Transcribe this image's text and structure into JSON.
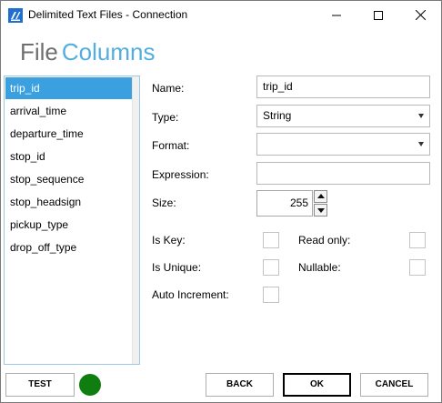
{
  "window": {
    "title": "Delimited Text Files - Connection",
    "icon": "app-icon",
    "controls": [
      "minimize-icon",
      "maximize-icon",
      "close-icon"
    ]
  },
  "header": {
    "word1": "File",
    "word2": "Columns"
  },
  "columns": {
    "items": [
      {
        "label": "trip_id",
        "selected": true
      },
      {
        "label": "arrival_time"
      },
      {
        "label": "departure_time"
      },
      {
        "label": "stop_id"
      },
      {
        "label": "stop_sequence"
      },
      {
        "label": "stop_headsign"
      },
      {
        "label": "pickup_type"
      },
      {
        "label": "drop_off_type"
      }
    ]
  },
  "properties": {
    "name_label": "Name:",
    "name_value": "trip_id",
    "type_label": "Type:",
    "type_value": "String",
    "format_label": "Format:",
    "format_value": "",
    "expression_label": "Expression:",
    "expression_value": "",
    "size_label": "Size:",
    "size_value": "255",
    "is_key_label": "Is Key:",
    "is_key_checked": false,
    "read_only_label": "Read only:",
    "read_only_checked": false,
    "is_unique_label": "Is Unique:",
    "is_unique_checked": false,
    "nullable_label": "Nullable:",
    "nullable_checked": false,
    "auto_increment_label": "Auto Increment:",
    "auto_increment_checked": false
  },
  "footer": {
    "test_label": "TEST",
    "status_color": "#0f7d0f",
    "back_label": "BACK",
    "ok_label": "OK",
    "cancel_label": "CANCEL"
  },
  "colors": {
    "accent": "#3aa0e0",
    "header_accent": "#52aee0",
    "header_muted": "#6e6e6e"
  }
}
